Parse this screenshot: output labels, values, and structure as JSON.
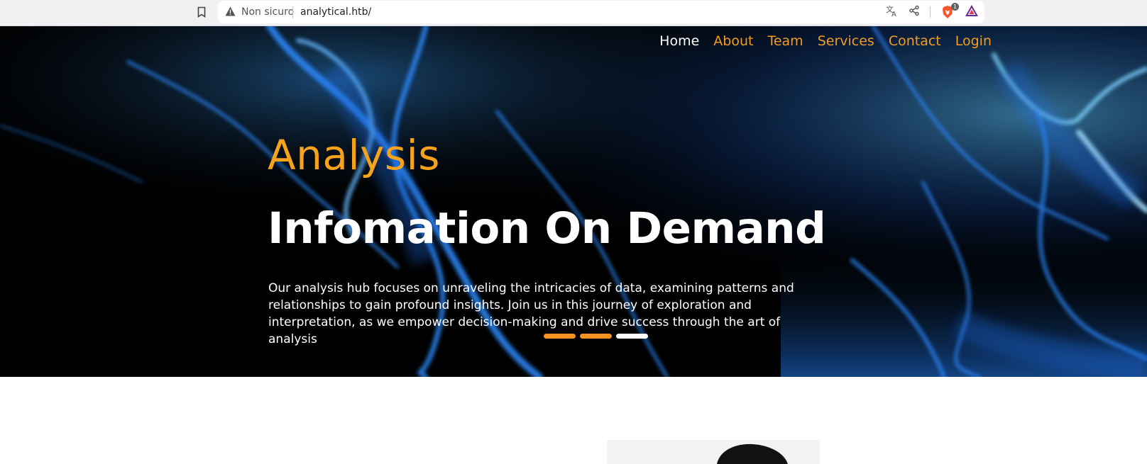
{
  "browser": {
    "security_label": "Non sicuro",
    "url": "analytical.htb/",
    "brave_shield_count": "1",
    "icons": [
      "bookmark-icon",
      "warning-icon",
      "translate-icon",
      "share-icon",
      "brave-shield-icon",
      "brave-rewards-icon"
    ]
  },
  "nav": {
    "items": [
      {
        "label": "Home",
        "active": true
      },
      {
        "label": "About"
      },
      {
        "label": "Team"
      },
      {
        "label": "Services"
      },
      {
        "label": "Contact"
      },
      {
        "label": "Login"
      }
    ]
  },
  "hero": {
    "subtitle": "Analysis",
    "title": "Infomation On Demand",
    "description": "Our analysis hub focuses on unraveling the intricacies of data, examining patterns and relationships to gain profound insights. Join us in this journey of exploration and interpretation, as we empower decision-making and drive success through the art of analysis",
    "slides": 3,
    "active_slide": 3
  },
  "colors": {
    "accent": "#f39c1f",
    "hero_bg": "#000000",
    "smoke": "#2f8bff",
    "text_light": "#ffffff"
  }
}
